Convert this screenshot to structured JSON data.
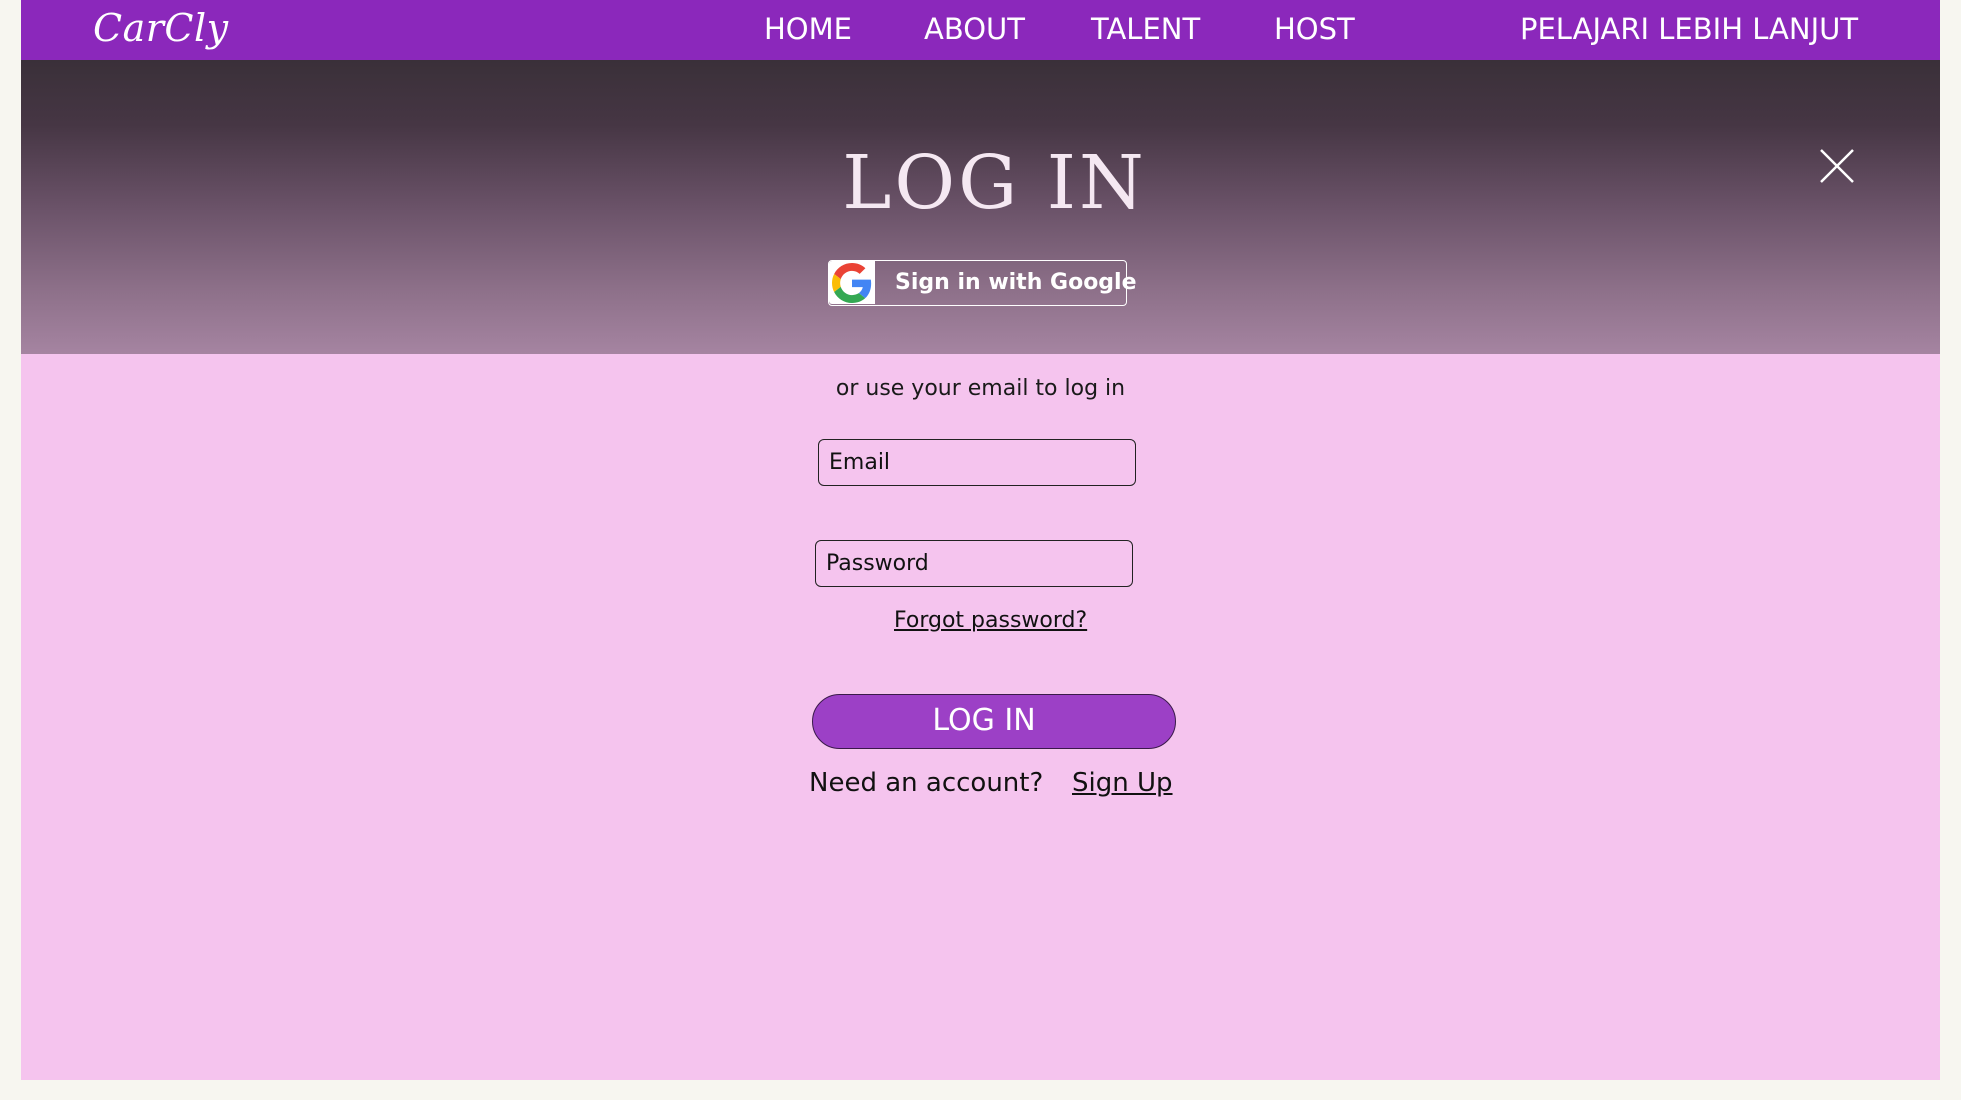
{
  "navbar": {
    "brand": "CarCly",
    "items": [
      {
        "label": "HOME"
      },
      {
        "label": "ABOUT"
      },
      {
        "label": "TALENT"
      },
      {
        "label": "HOST"
      },
      {
        "label": "PELAJARI LEBIH LANJUT"
      }
    ]
  },
  "modal": {
    "title": "LOG IN",
    "close_icon": "close-icon",
    "google_button": {
      "label": "Sign in with Google",
      "icon": "google-icon"
    },
    "divider_text": "or use your email to log in",
    "email_placeholder": "Email",
    "password_placeholder": "Password",
    "forgot_password": "Forgot password?",
    "login_button": "LOG IN",
    "need_account": "Need an account?",
    "signup_link": "Sign Up"
  },
  "colors": {
    "navbar": "#8b28bb",
    "page_background": "#f5c4ee",
    "login_button": "#9c40c6"
  }
}
